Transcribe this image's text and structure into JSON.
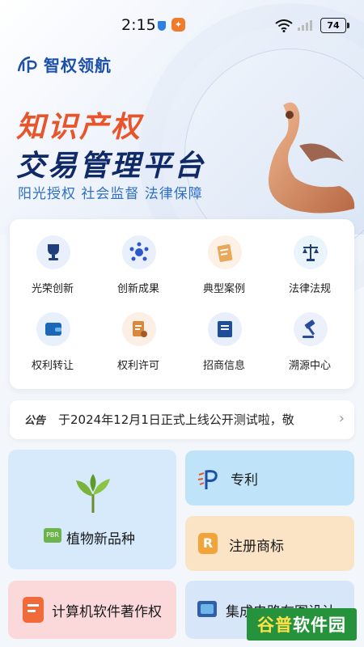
{
  "status_bar": {
    "time": "2:15",
    "battery": "74"
  },
  "brand": {
    "logo_text": "智权领航"
  },
  "hero": {
    "title_line1": "知识产权",
    "title_line2": "交易管理平台",
    "slogan": "阳光授权 社会监督 法律保障"
  },
  "grid": {
    "items": [
      {
        "label": "光荣创新",
        "icon": "trophy-icon"
      },
      {
        "label": "创新成果",
        "icon": "network-icon"
      },
      {
        "label": "典型案例",
        "icon": "document-icon"
      },
      {
        "label": "法律法规",
        "icon": "scales-icon"
      },
      {
        "label": "权利转让",
        "icon": "wallet-icon"
      },
      {
        "label": "权利许可",
        "icon": "license-icon"
      },
      {
        "label": "招商信息",
        "icon": "book-icon"
      },
      {
        "label": "溯源中心",
        "icon": "gavel-icon"
      }
    ]
  },
  "notice": {
    "tag": "公告",
    "text": "于2024年12月1日正式上线公开测试啦，敬"
  },
  "tiles": {
    "plant": {
      "label": "植物新品种",
      "badge": "PBR"
    },
    "patent": {
      "label": "专利"
    },
    "trademark": {
      "label": "注册商标",
      "badge": "R"
    },
    "software": {
      "label": "计算机软件著作权"
    },
    "circuit": {
      "label": "集成电路布图设计"
    }
  },
  "watermark": {
    "part1": "谷普",
    "part2": "软件园"
  },
  "colors": {
    "brand_blue": "#1c4fa8",
    "title_orange": "#e8552a",
    "title_navy": "#0f2a66"
  }
}
